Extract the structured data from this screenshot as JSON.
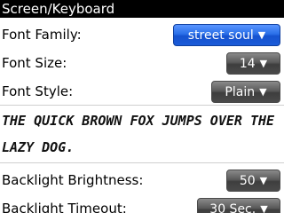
{
  "title": "Screen/Keyboard",
  "settings": {
    "font_family": {
      "label": "Font Family:",
      "value": "street soul"
    },
    "font_size": {
      "label": "Font Size:",
      "value": "14"
    },
    "font_style": {
      "label": "Font Style:",
      "value": "Plain"
    },
    "preview_text": "The quick brown fox jumps over the lazy dog.",
    "backlight_brightness": {
      "label": "Backlight Brightness:",
      "value": "50"
    },
    "backlight_timeout": {
      "label": "Backlight Timeout:",
      "value": "30 Sec."
    }
  },
  "icons": {
    "dropdown_arrow": "triangle-down"
  },
  "colors": {
    "titlebar_bg": "#000000",
    "focused_dropdown": "#1b5bd8",
    "dropdown": "#4a4a4a"
  }
}
